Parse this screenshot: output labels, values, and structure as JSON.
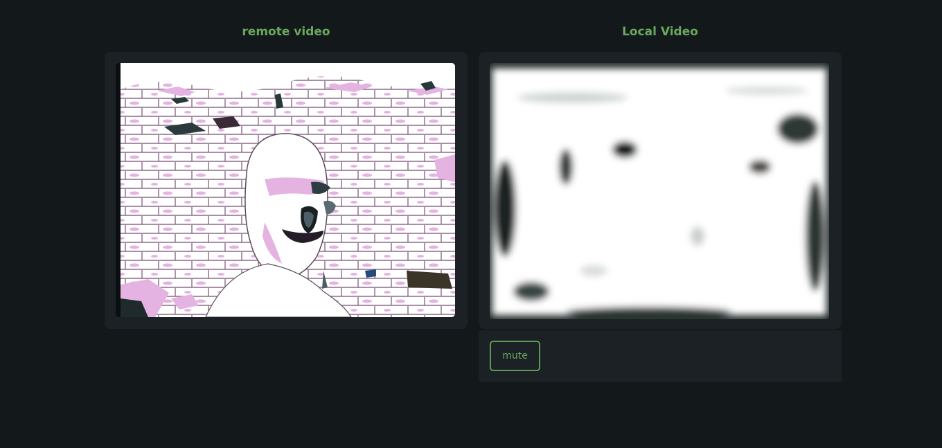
{
  "remote": {
    "title": "remote video"
  },
  "local": {
    "title": "Local Video",
    "mute_label": "mute"
  },
  "colors": {
    "background": "#13181b",
    "card": "#1b2124",
    "accent": "#6aa95d"
  }
}
